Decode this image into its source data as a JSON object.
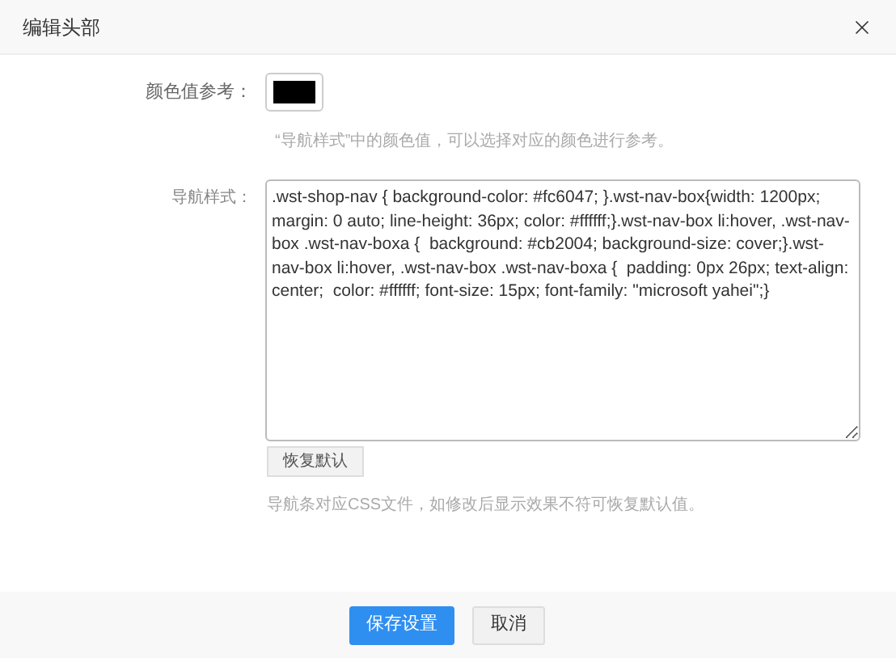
{
  "dialog": {
    "title": "编辑头部"
  },
  "color_reference": {
    "label": "颜色值参考：",
    "color": "#000000",
    "hint": "“导航样式”中的颜色值，可以选择对应的颜色进行参考。"
  },
  "nav_style": {
    "label": "导航样式：",
    "value": ".wst-shop-nav { background-color: #fc6047; }.wst-nav-box{width: 1200px; margin: 0 auto; line-height: 36px; color: #ffffff;}.wst-nav-box li:hover, .wst-nav-box .wst-nav-boxa {  background: #cb2004; background-size: cover;}.wst-nav-box li:hover, .wst-nav-box .wst-nav-boxa {  padding: 0px 26px; text-align: center;  color: #ffffff; font-size: 15px; font-family: \"microsoft yahei\";}",
    "reset_button": "恢复默认",
    "hint": "导航条对应CSS文件，如修改后显示效果不符可恢复默认值。"
  },
  "footer": {
    "buttons": [
      {
        "label": "保存设置",
        "kind": "primary"
      },
      {
        "label": "取消",
        "kind": "secondary"
      }
    ]
  }
}
